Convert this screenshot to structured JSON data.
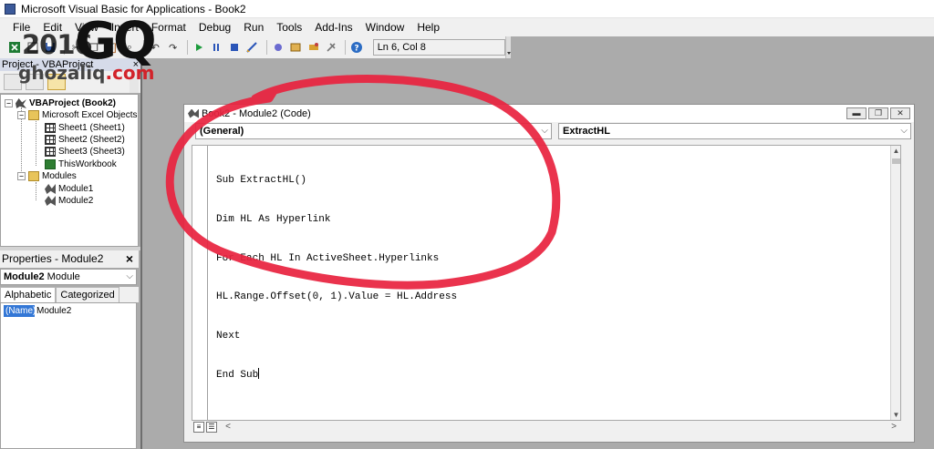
{
  "window": {
    "title": "Microsoft Visual Basic for Applications - Book2"
  },
  "menu": [
    "File",
    "Edit",
    "View",
    "Insert",
    "Format",
    "Debug",
    "Run",
    "Tools",
    "Add-Ins",
    "Window",
    "Help"
  ],
  "toolbar": {
    "position_text": "Ln 6, Col 8"
  },
  "watermark": {
    "year": "2016",
    "logo": "GQ",
    "site": "ghozaliq",
    "tld": ".com"
  },
  "project": {
    "header": "Project - VBAProject",
    "close": "×",
    "root": "VBAProject (Book2)",
    "objects_folder": "Microsoft Excel Objects",
    "sheets": [
      "Sheet1 (Sheet1)",
      "Sheet2 (Sheet2)",
      "Sheet3 (Sheet3)",
      "ThisWorkbook"
    ],
    "modules_folder": "Modules",
    "modules": [
      "Module1",
      "Module2"
    ]
  },
  "properties": {
    "header": "Properties - Module2",
    "close": "×",
    "object_bold": "Module2",
    "object_type": " Module",
    "tabs": [
      "Alphabetic",
      "Categorized"
    ],
    "row_name": "(Name)",
    "row_value": "Module2"
  },
  "code_window": {
    "title": "Book2 - Module2 (Code)",
    "object_combo": "(General)",
    "proc_combo": "ExtractHL",
    "lines": [
      "Sub ExtractHL()",
      "Dim HL As Hyperlink",
      "For Each HL In ActiveSheet.Hyperlinks",
      "HL.Range.Offset(0, 1).Value = HL.Address",
      "Next",
      "End Sub"
    ]
  },
  "colors": {
    "annotation": "#e8243f",
    "selection": "#3377d6",
    "workspace": "#ababab"
  }
}
